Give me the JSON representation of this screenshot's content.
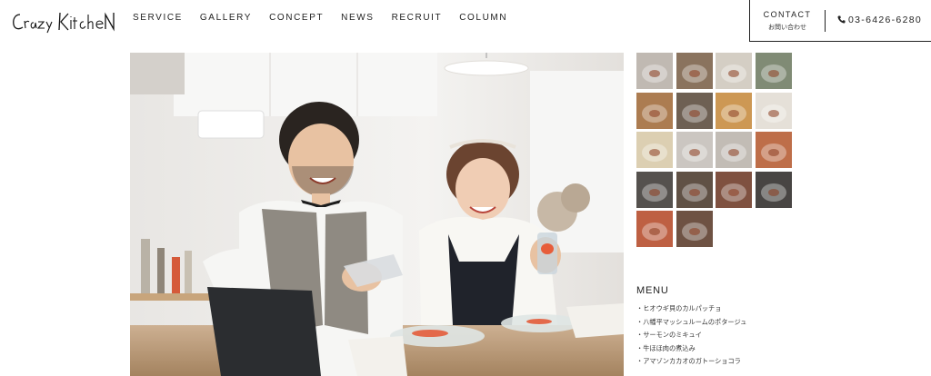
{
  "header": {
    "logo_text": "Crazy Kitchen",
    "nav": [
      {
        "label": "SERVICE"
      },
      {
        "label": "GALLERY"
      },
      {
        "label": "CONCEPT"
      },
      {
        "label": "NEWS"
      },
      {
        "label": "RECRUIT"
      },
      {
        "label": "COLUMN"
      }
    ],
    "contact": {
      "label": "CONTACT",
      "sublabel": "お問い合わせ"
    },
    "phone": "03-6426-6280"
  },
  "hero": {
    "icon": "photo-couple-cooking"
  },
  "gallery": {
    "thumbnails": [
      {
        "icon": "thumb-chef-portrait",
        "color": "#b8b0a8"
      },
      {
        "icon": "thumb-plated-dish",
        "color": "#7a6048"
      },
      {
        "icon": "thumb-cutlery",
        "color": "#cfc8bc"
      },
      {
        "icon": "thumb-green-dish",
        "color": "#6f7b62"
      },
      {
        "icon": "thumb-prep",
        "color": "#a16a3a"
      },
      {
        "icon": "thumb-dark-plate",
        "color": "#5a4b3c"
      },
      {
        "icon": "thumb-round-plate",
        "color": "#c78a3d"
      },
      {
        "icon": "thumb-soup-bowl",
        "color": "#e2dcd3"
      },
      {
        "icon": "thumb-cream-soup",
        "color": "#d8c9a8"
      },
      {
        "icon": "thumb-couple",
        "color": "#c4bfb9"
      },
      {
        "icon": "thumb-staff",
        "color": "#bab3ab"
      },
      {
        "icon": "thumb-salad",
        "color": "#b55a30"
      },
      {
        "icon": "thumb-pan",
        "color": "#3e3a36"
      },
      {
        "icon": "thumb-stew",
        "color": "#4b3a2c"
      },
      {
        "icon": "thumb-meat",
        "color": "#6e3a26"
      },
      {
        "icon": "thumb-black-plate",
        "color": "#2f2c2a"
      },
      {
        "icon": "thumb-tomato",
        "color": "#b64b2a"
      },
      {
        "icon": "thumb-cake",
        "color": "#5a3b2a"
      }
    ]
  },
  "menu": {
    "title": "MENU",
    "items": [
      {
        "label": "ヒオウギ貝のカルパッチョ"
      },
      {
        "label": "八幡平マッシュルームのポタージュ"
      },
      {
        "label": "サーモンのミキュイ"
      },
      {
        "label": "牛ほほ肉の煮込み"
      },
      {
        "label": "アマゾンカカオのガトーショコラ"
      }
    ]
  }
}
